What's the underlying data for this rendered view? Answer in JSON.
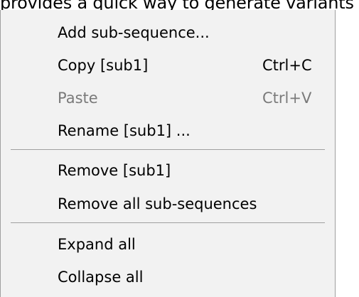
{
  "background_text": "provides a quick way to generate variants",
  "menu": {
    "items": [
      {
        "label": "Add sub-sequence...",
        "shortcut": "",
        "enabled": true
      },
      {
        "label": "Copy  [sub1]",
        "shortcut": "Ctrl+C",
        "enabled": true
      },
      {
        "label": "Paste",
        "shortcut": "Ctrl+V",
        "enabled": false
      },
      {
        "label": "Rename [sub1] ...",
        "shortcut": "",
        "enabled": true
      },
      {
        "label": "Remove [sub1]",
        "shortcut": "",
        "enabled": true
      },
      {
        "label": "Remove all sub-sequences",
        "shortcut": "",
        "enabled": true
      },
      {
        "label": "Expand all",
        "shortcut": "",
        "enabled": true
      },
      {
        "label": "Collapse all",
        "shortcut": "",
        "enabled": true
      }
    ]
  }
}
